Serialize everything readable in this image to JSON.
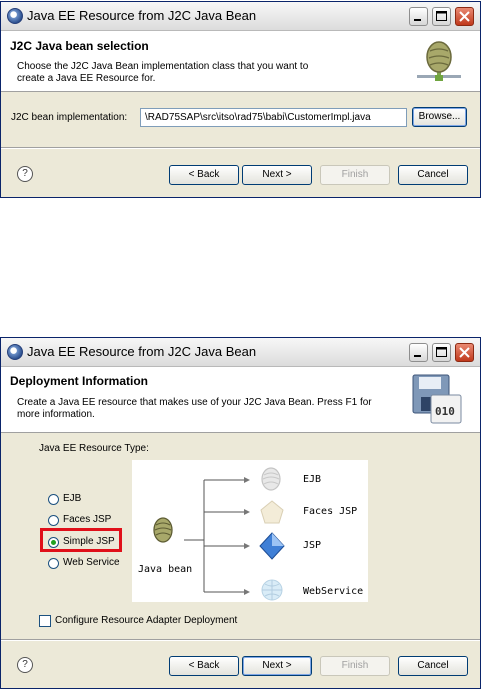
{
  "dialog1": {
    "window_title": "Java EE Resource from J2C Java Bean",
    "header_title": "J2C Java bean selection",
    "header_desc_line1": "Choose the J2C Java Bean implementation class that you want to",
    "header_desc_line2": "create a Java EE Resource for.",
    "impl_label": "J2C bean implementation:",
    "impl_value": "\\RAD75SAP\\src\\itso\\rad75\\babi\\CustomerImpl.java",
    "browse_label": "Browse...",
    "help_label": "?",
    "back_label": "< Back",
    "next_label": "Next >",
    "finish_label": "Finish",
    "cancel_label": "Cancel"
  },
  "dialog2": {
    "window_title": "Java EE Resource from J2C Java Bean",
    "header_title": "Deployment Information",
    "header_desc_line1": "Create a Java EE resource that makes use of your J2C Java Bean. Press F1 for",
    "header_desc_line2": "more information.",
    "header_icon_text": "010",
    "resource_type_label": "Java EE Resource Type:",
    "options": [
      {
        "label": "EJB",
        "selected": false
      },
      {
        "label": "Faces JSP",
        "selected": false
      },
      {
        "label": "Simple JSP",
        "selected": true
      },
      {
        "label": "Web Service",
        "selected": false
      }
    ],
    "diagram": {
      "source": "Java bean",
      "targets": [
        "EJB",
        "Faces JSP",
        "JSP",
        "WebService"
      ]
    },
    "configure_label": "Configure Resource Adapter Deployment",
    "configure_checked": false,
    "help_label": "?",
    "back_label": "< Back",
    "next_label": "Next >",
    "finish_label": "Finish",
    "cancel_label": "Cancel"
  },
  "colors": {
    "highlight": "#e0101a",
    "selected_radio": "#21a121"
  }
}
